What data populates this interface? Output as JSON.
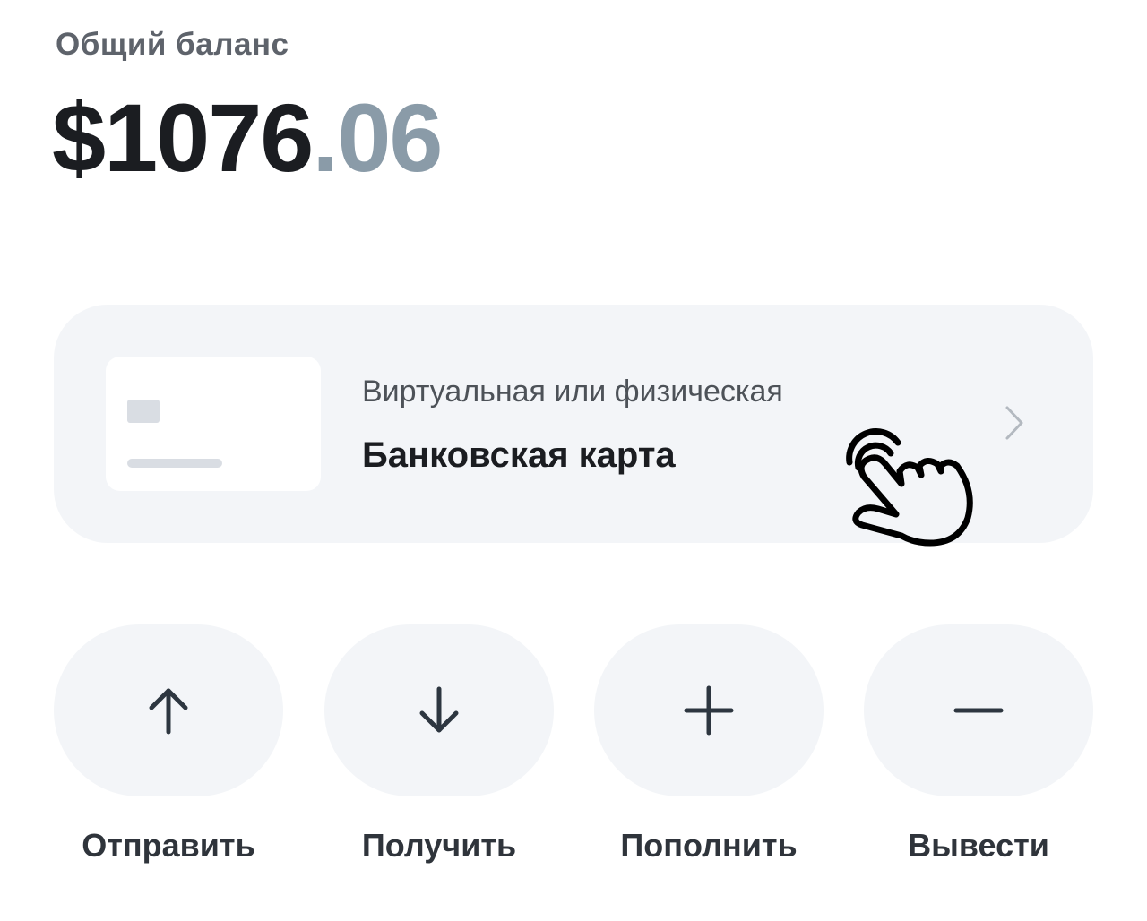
{
  "balance": {
    "label": "Общий баланс",
    "amount_whole": "$1076",
    "amount_fraction": ".06"
  },
  "card_option": {
    "subtitle": "Виртуальная или физическая",
    "title": "Банковская карта",
    "icon": "chevron-right-icon"
  },
  "actions": [
    {
      "label": "Отправить",
      "icon": "arrow-up-icon"
    },
    {
      "label": "Получить",
      "icon": "arrow-down-icon"
    },
    {
      "label": "Пополнить",
      "icon": "plus-icon"
    },
    {
      "label": "Вывести",
      "icon": "minus-icon"
    }
  ],
  "colors": {
    "primary_text": "#1b1d21",
    "muted_fraction": "#8a9ba8",
    "surface": "#f3f5f8",
    "icon": "#2d3640"
  }
}
